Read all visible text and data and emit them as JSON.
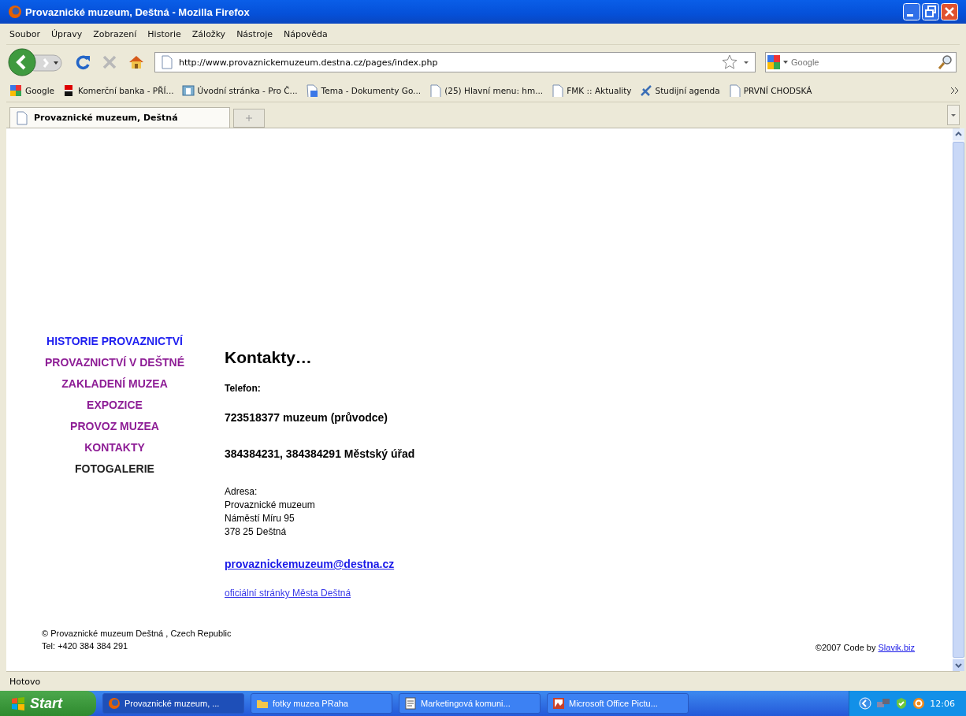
{
  "window": {
    "title": "Provaznické muzeum, Deštná - Mozilla Firefox"
  },
  "menu": [
    "Soubor",
    "Úpravy",
    "Zobrazení",
    "Historie",
    "Záložky",
    "Nástroje",
    "Nápověda"
  ],
  "address": {
    "value": "http://www.provaznickemuzeum.destna.cz/pages/index.php"
  },
  "search": {
    "placeholder": "Google"
  },
  "bookmarks": [
    {
      "label": "Google",
      "kind": "google"
    },
    {
      "label": "Komerční banka - PŘÍ...",
      "kind": "bank"
    },
    {
      "label": "Úvodní stránka - Pro Č...",
      "kind": "site"
    },
    {
      "label": "Tema - Dokumenty Go...",
      "kind": "doc"
    },
    {
      "label": "(25) Hlavní menu: hm...",
      "kind": "page"
    },
    {
      "label": "FMK :: Aktuality",
      "kind": "page"
    },
    {
      "label": "Studijní agenda",
      "kind": "agenda"
    },
    {
      "label": "PRVNÍ CHODSKÁ",
      "kind": "page"
    }
  ],
  "tabs": [
    {
      "label": "Provaznické muzeum, Deštná",
      "selected": true
    }
  ],
  "nav": [
    {
      "label": "HISTORIE PROVAZNICTVÍ",
      "kind": "link"
    },
    {
      "label": "PROVAZNICTVÍ V DEŠTNÉ",
      "kind": "visited"
    },
    {
      "label": "ZAKLADENÍ MUZEA",
      "kind": "visited"
    },
    {
      "label": "EXPOZICE",
      "kind": "visited"
    },
    {
      "label": "PROVOZ MUZEA",
      "kind": "visited"
    },
    {
      "label": "KONTAKTY",
      "kind": "visited"
    },
    {
      "label": "FOTOGALERIE",
      "kind": "current"
    }
  ],
  "content": {
    "heading": "Kontakty…",
    "phone_label": "Telefon:",
    "phones": [
      "723518377 muzeum (průvodce)",
      "384384231, 384384291 Městský úřad"
    ],
    "address_lines": [
      "Adresa:",
      "Provaznické muzeum",
      "Náměstí Míru 95",
      "378 25 Deštná"
    ],
    "email": "provaznickemuzeum@destna.cz",
    "city_link": "oficiální stránky Města Deštná"
  },
  "footer": {
    "lines": [
      "© Provaznické muzeum Deštná , Czech Republic",
      "Tel: +420 384 384 291"
    ],
    "credit": "©2007 Code by ",
    "credit_link": "Slavik.biz"
  },
  "status_bar": "Hotovo",
  "taskbar": {
    "start": "Start",
    "items": [
      {
        "label": "Provaznické muzeum, ...",
        "selected": true,
        "kind": "firefox"
      },
      {
        "label": "fotky muzea PRaha",
        "selected": false,
        "kind": "folder"
      },
      {
        "label": "Marketingová komuni...",
        "selected": false,
        "kind": "doc"
      },
      {
        "label": "Microsoft Office Pictu...",
        "selected": false,
        "kind": "picture"
      }
    ],
    "clock": "12:06"
  }
}
